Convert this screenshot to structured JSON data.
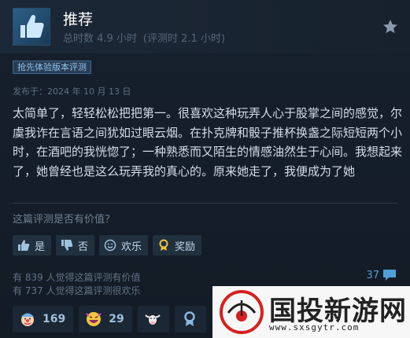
{
  "header": {
    "title": "推荐",
    "hours_total": "总时数 4.9 小时",
    "hours_at_review": "(评测时 2.1 小时)"
  },
  "badge": {
    "early_access": "抢先体验版本评测"
  },
  "review": {
    "posted": "发布于：2024 年 10 月 13 日",
    "body": "太简单了，轻轻松松把把第一。很喜欢这种玩弄人心于股掌之间的感觉，尔虞我诈在言语之间犹如过眼云烟。在扑克牌和骰子推杯换盏之际短短两个小时，在酒吧的我恍惚了；一种熟悉而又陌生的情感油然生于心间。我想起来了，她曾经也是这么玩弄我的真心的。原来她走了，我便成为了她"
  },
  "helpful": {
    "question": "这篇评测是否有价值？",
    "buttons": {
      "yes": "是",
      "no": "否",
      "funny": "欢乐",
      "award": "奖励"
    },
    "stats_helpful": "有 839 人觉得这篇评测有价值",
    "stats_funny": "有 737 人觉得这篇评测很欢乐",
    "comments": "37"
  },
  "awards": [
    {
      "icon": "clown-icon",
      "count": "169"
    },
    {
      "icon": "laughing-face-icon",
      "count": "29"
    },
    {
      "icon": "cow-icon",
      "count": ""
    },
    {
      "icon": "ribbon-icon",
      "count": ""
    }
  ],
  "watermark": {
    "name": "国投新游网",
    "url": "www.sxsgytr.com"
  },
  "colors": {
    "background": "#131b25",
    "accent": "#4e9fd8",
    "badge_border": "#3d6a94"
  }
}
